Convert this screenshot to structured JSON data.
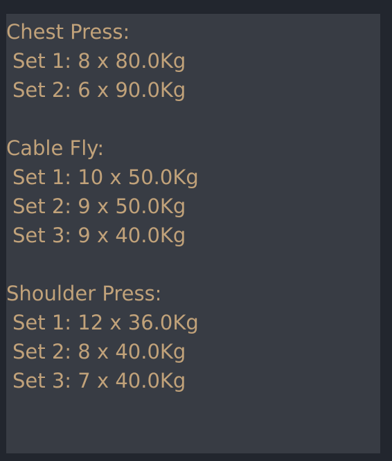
{
  "workout": {
    "exercises": [
      {
        "title": "Chest Press:",
        "sets": [
          "Set 1: 8 x 80.0Kg",
          "Set 2: 6 x 90.0Kg"
        ]
      },
      {
        "title": "Cable Fly:",
        "sets": [
          "Set 1: 10 x 50.0Kg",
          "Set 2: 9 x 50.0Kg",
          "Set 3: 9 x 40.0Kg"
        ]
      },
      {
        "title": "Shoulder Press:",
        "sets": [
          "Set 1: 12 x 36.0Kg",
          "Set 2: 8 x 40.0Kg",
          "Set 3: 7 x 40.0Kg"
        ]
      }
    ]
  },
  "colors": {
    "background": "#22262e",
    "panel": "#383c44",
    "text": "#c1a27a"
  }
}
